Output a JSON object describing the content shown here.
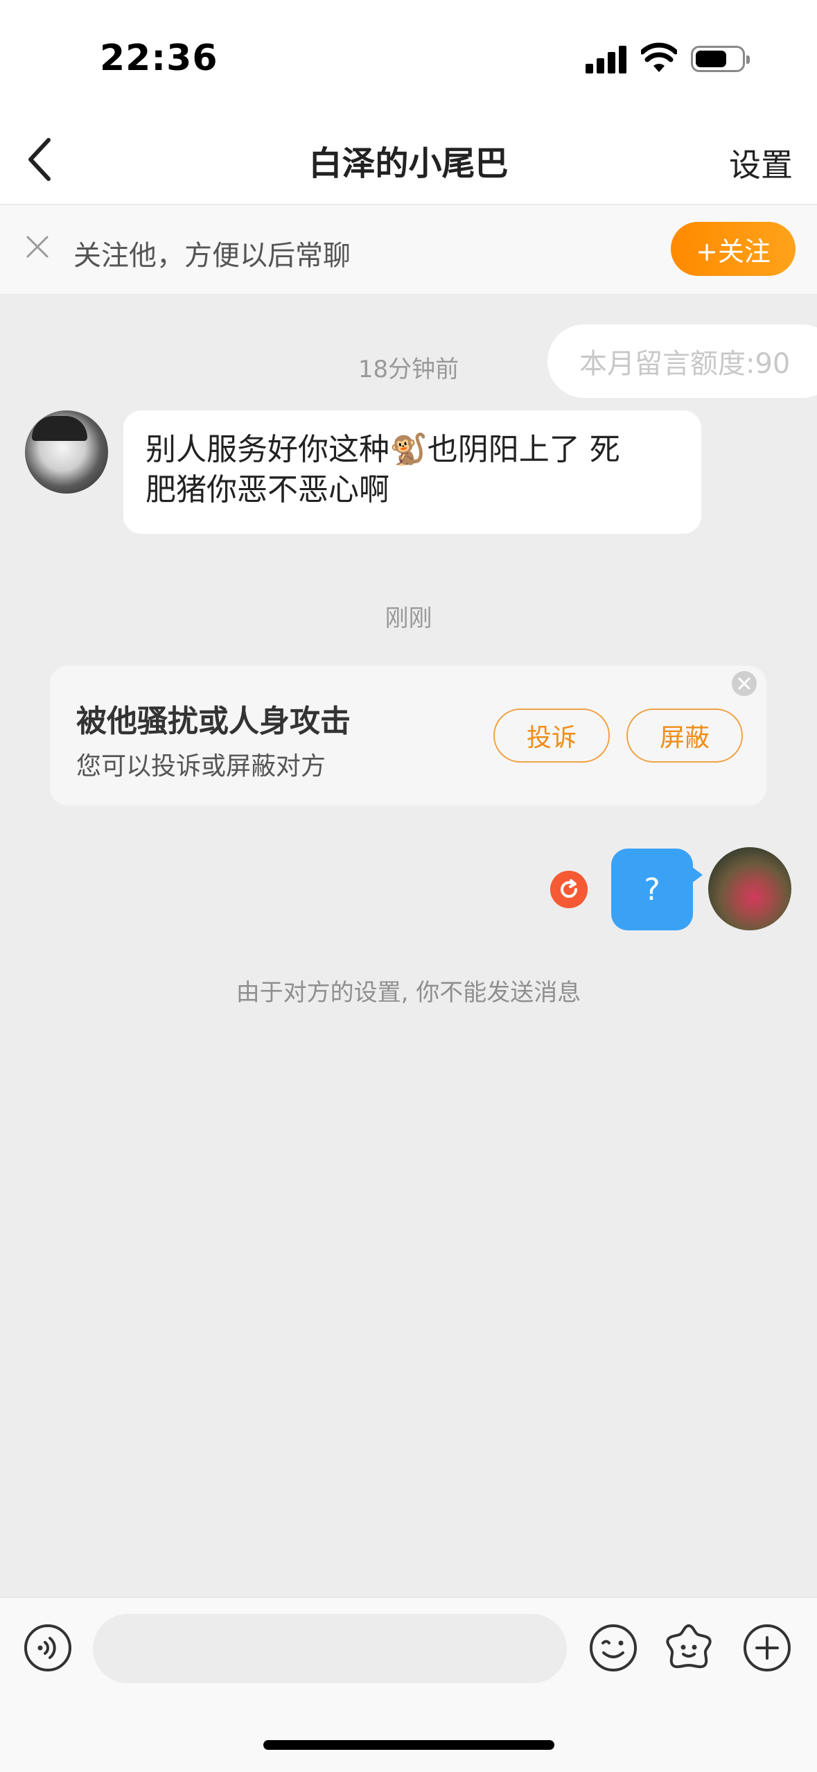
{
  "status_bar": {
    "time": "22:36"
  },
  "nav": {
    "title": "白泽的小尾巴",
    "settings_label": "设置"
  },
  "follow_banner": {
    "text": "关注他，方便以后常聊",
    "button_label": "+关注"
  },
  "chat": {
    "quota_text": "本月留言额度:90",
    "timestamp_1": "18分钟前",
    "incoming_message_line1": "别人服务好你这种🐒也阴阳上了 死",
    "incoming_message_line2": "肥猪你恶不恶心啊",
    "timestamp_2": "刚刚",
    "report_card": {
      "title": "被他骚扰或人身攻击",
      "subtitle": "您可以投诉或屏蔽对方",
      "complain_label": "投诉",
      "block_label": "屏蔽"
    },
    "outgoing_message": "?",
    "system_note": "由于对方的设置, 你不能发送消息"
  },
  "colors": {
    "accent_orange": "#ff8a00",
    "outgoing_bubble": "#3aa2f5",
    "retry_red": "#f55a34",
    "background": "#ededed"
  },
  "icons": [
    "back-chevron-icon",
    "close-icon",
    "retry-icon",
    "voice-icon",
    "emoji-icon",
    "sticker-icon",
    "plus-icon"
  ]
}
